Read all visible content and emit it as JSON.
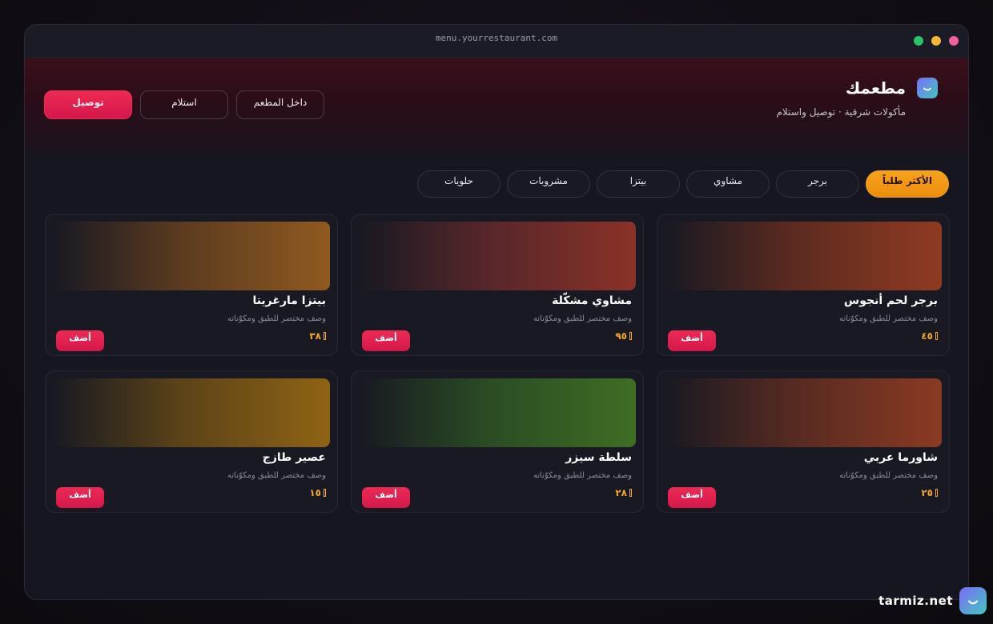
{
  "window": {
    "url": "menu.yourrestaurant.com",
    "controls": [
      {
        "name": "close",
        "color": "#f0609c"
      },
      {
        "name": "minimize",
        "color": "#f5b731"
      },
      {
        "name": "maximize",
        "color": "#2bc269"
      }
    ]
  },
  "header": {
    "title": "مطعمك",
    "tagline": "مأكولات شرقية · توصيل واستلام",
    "logo_icon": "smile-icon",
    "modes": [
      {
        "label": "توصيل",
        "active": true
      },
      {
        "label": "استلام",
        "active": false
      },
      {
        "label": "داخل المطعم",
        "active": false
      }
    ]
  },
  "categories": [
    {
      "label": "الأكثر طلباً",
      "active": true
    },
    {
      "label": "برجر",
      "active": false
    },
    {
      "label": "مشاوي",
      "active": false
    },
    {
      "label": "بيتزا",
      "active": false
    },
    {
      "label": "مشروبات",
      "active": false
    },
    {
      "label": "حلويات",
      "active": false
    }
  ],
  "menu": {
    "add_label": "أضف",
    "currency_icon": "riyal-icon",
    "items": [
      {
        "name": "برجر لحم أنجوس",
        "desc": "وصف مختصر للطبق ومكوّناته",
        "price": "٤٥",
        "color": "#8f3a22"
      },
      {
        "name": "مشاوي مشكّلة",
        "desc": "وصف مختصر للطبق ومكوّناته",
        "price": "٩٥",
        "color": "#8a3228"
      },
      {
        "name": "بيتزا مارغريتا",
        "desc": "وصف مختصر للطبق ومكوّناته",
        "price": "٣٨",
        "color": "#8f5a20"
      },
      {
        "name": "شاورما عربي",
        "desc": "وصف مختصر للطبق ومكوّناته",
        "price": "٢٥",
        "color": "#8a3a22"
      },
      {
        "name": "سلطة سيزر",
        "desc": "وصف مختصر للطبق ومكوّناته",
        "price": "٢٨",
        "color": "#3f6e24"
      },
      {
        "name": "عصير طازج",
        "desc": "وصف مختصر للطبق ومكوّناته",
        "price": "١٥",
        "color": "#8f6314"
      }
    ]
  },
  "watermark": {
    "text": "tarmiz.net",
    "icon": "smile-icon"
  },
  "colors": {
    "accent_red": "#e4204f",
    "accent_orange": "#f5a623",
    "background": "#15161f"
  }
}
